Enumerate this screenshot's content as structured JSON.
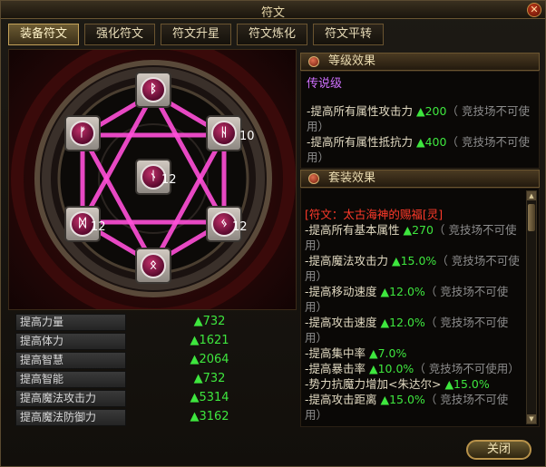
{
  "window": {
    "title": "符文"
  },
  "tabs": [
    {
      "label": "装备符文",
      "active": true
    },
    {
      "label": "强化符文",
      "active": false
    },
    {
      "label": "符文升星",
      "active": false
    },
    {
      "label": "符文炼化",
      "active": false
    },
    {
      "label": "符文平转",
      "active": false
    }
  ],
  "runes": [
    {
      "glyph": "ᛒ",
      "count": ""
    },
    {
      "glyph": "ᚠ",
      "count": ""
    },
    {
      "glyph": "ᚺ",
      "count": "10"
    },
    {
      "glyph": "ᚾ",
      "count": "12"
    },
    {
      "glyph": "ᛞ",
      "count": "12"
    },
    {
      "glyph": "ᛃ",
      "count": "12"
    },
    {
      "glyph": "ᛟ",
      "count": ""
    }
  ],
  "stats": [
    {
      "label": "提高力量",
      "value": "▲732"
    },
    {
      "label": "提高体力",
      "value": "▲1621"
    },
    {
      "label": "提高智慧",
      "value": "▲2064"
    },
    {
      "label": "提高智能",
      "value": "▲732"
    },
    {
      "label": "提高魔法攻击力",
      "value": "▲5314"
    },
    {
      "label": "提高魔法防御力",
      "value": "▲3162"
    }
  ],
  "level_effect": {
    "header": "等级效果",
    "grade": "传说级",
    "lines": [
      {
        "text": "-提高所有属性攻击力 ",
        "val": "▲200",
        "note": "（ 竞技场不可使用）"
      },
      {
        "text": "-提高所有属性抵抗力 ",
        "val": "▲400",
        "note": "（ 竞技场不可使用）"
      }
    ]
  },
  "set_effect": {
    "header": "套装效果",
    "title": "[符文：太古海神的赐福[灵]",
    "lines": [
      {
        "text": "-提高所有基本属性 ",
        "val": "▲270",
        "note": "（ 竞技场不可使用）"
      },
      {
        "text": "-提高魔法攻击力 ",
        "val": "▲15.0%",
        "note": "（ 竞技场不可使用）"
      },
      {
        "text": "-提高移动速度 ",
        "val": "▲12.0%",
        "note": "（ 竞技场不可使用）"
      },
      {
        "text": "-提高攻击速度 ",
        "val": "▲12.0%",
        "note": "（ 竞技场不可使用）"
      },
      {
        "text": "-提高集中率 ",
        "val": "▲7.0%",
        "note": ""
      },
      {
        "text": "-提高暴击率 ",
        "val": "▲10.0%",
        "note": "（ 竞技场不可使用）"
      },
      {
        "text": "-势力抗魔力增加<朱达尔> ",
        "val": "▲15.0%",
        "note": ""
      },
      {
        "text": "-提高攻击距离 ",
        "val": "▲15.0%",
        "note": "（ 竞技场不可使用）"
      }
    ]
  },
  "buttons": {
    "close": "关闭",
    "close_x": "✕"
  },
  "colors": {
    "green": "#3ee63e",
    "purple": "#d070ff",
    "red": "#ff3a2a",
    "magenta": "#ff4fd8"
  }
}
